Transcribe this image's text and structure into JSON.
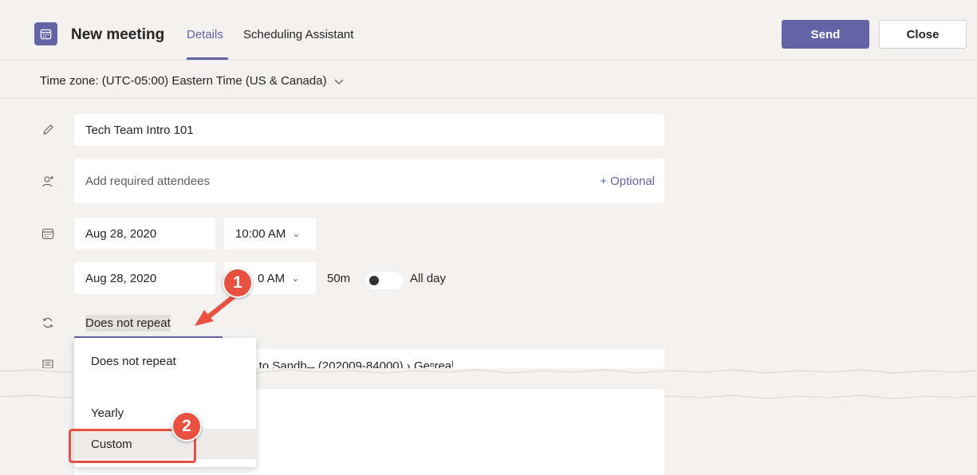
{
  "header": {
    "title": "New meeting",
    "tabs": [
      {
        "label": "Details",
        "active": true
      },
      {
        "label": "Scheduling Assistant",
        "active": false
      }
    ],
    "send_label": "Send",
    "close_label": "Close"
  },
  "timezone": {
    "label": "Time zone: (UTC-05:00) Eastern Time (US & Canada)"
  },
  "form": {
    "title_value": "Tech Team Intro 101",
    "attendees_placeholder": "Add required attendees",
    "optional_label": "+ Optional",
    "start_date": "Aug 28, 2020",
    "start_time": "10:00 AM",
    "end_date": "Aug 28, 2020",
    "end_time": "0 AM",
    "duration": "50m",
    "allday_label": "All day",
    "repeat_value": "Does not repeat",
    "channel_text": "tro to Sandb˗˗ (202009-84000)    ›   Geⁿreaˡ"
  },
  "repeat_dropdown": {
    "options": [
      "Does not repeat",
      "Yearly",
      "Custom"
    ],
    "highlighted": "Custom"
  },
  "callouts": [
    "1",
    "2"
  ],
  "colors": {
    "accent": "#6264a7",
    "callout": "#e8503f",
    "background": "#f3f2f1"
  }
}
